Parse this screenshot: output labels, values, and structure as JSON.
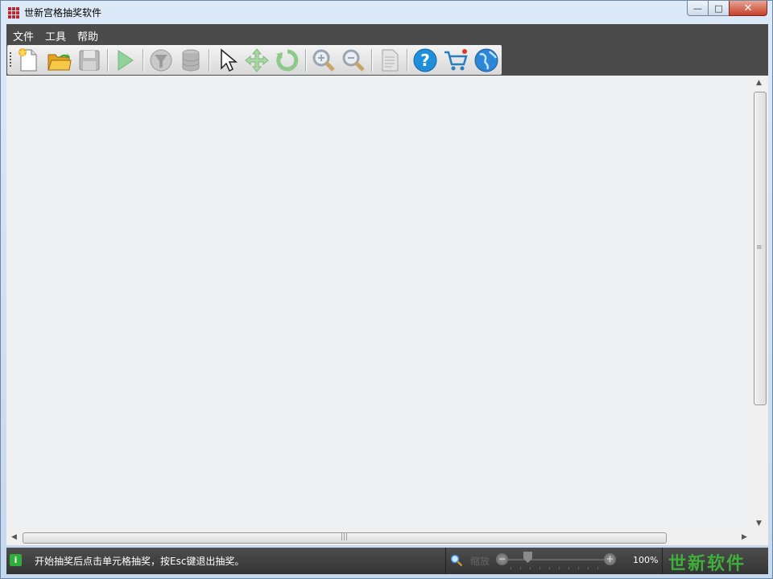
{
  "window": {
    "title": "世新宫格抽奖软件",
    "controls": {
      "minimize": "—",
      "maximize": "□",
      "close": "✕"
    }
  },
  "menu": {
    "items": [
      "文件",
      "工具",
      "帮助"
    ]
  },
  "toolbar": {
    "buttons": [
      {
        "icon": "new-file-icon",
        "enabled": true
      },
      {
        "icon": "open-folder-icon",
        "enabled": true
      },
      {
        "icon": "save-disk-icon",
        "enabled": false
      },
      {
        "icon": "play-icon",
        "enabled": false
      },
      {
        "icon": "filter-icon",
        "enabled": false
      },
      {
        "icon": "database-icon",
        "enabled": false
      },
      {
        "icon": "pointer-icon",
        "enabled": true
      },
      {
        "icon": "move-icon",
        "enabled": false
      },
      {
        "icon": "rotate-icon",
        "enabled": false
      },
      {
        "icon": "zoom-in-icon",
        "enabled": false
      },
      {
        "icon": "zoom-out-icon",
        "enabled": false
      },
      {
        "icon": "document-icon",
        "enabled": false
      },
      {
        "icon": "help-icon",
        "enabled": true
      },
      {
        "icon": "cart-icon",
        "enabled": true
      },
      {
        "icon": "globe-icon",
        "enabled": true
      }
    ]
  },
  "status": {
    "message": "开始抽奖后点击单元格抽奖，按Esc键退出抽奖。",
    "zoom_label": "缩放",
    "zoom_value": "100%",
    "brand": "世新软件"
  },
  "colors": {
    "dark_bar": "#4b4b4b",
    "canvas": "#eff0f2",
    "brand_green": "#3fae3a",
    "close_red": "#c7412b"
  }
}
